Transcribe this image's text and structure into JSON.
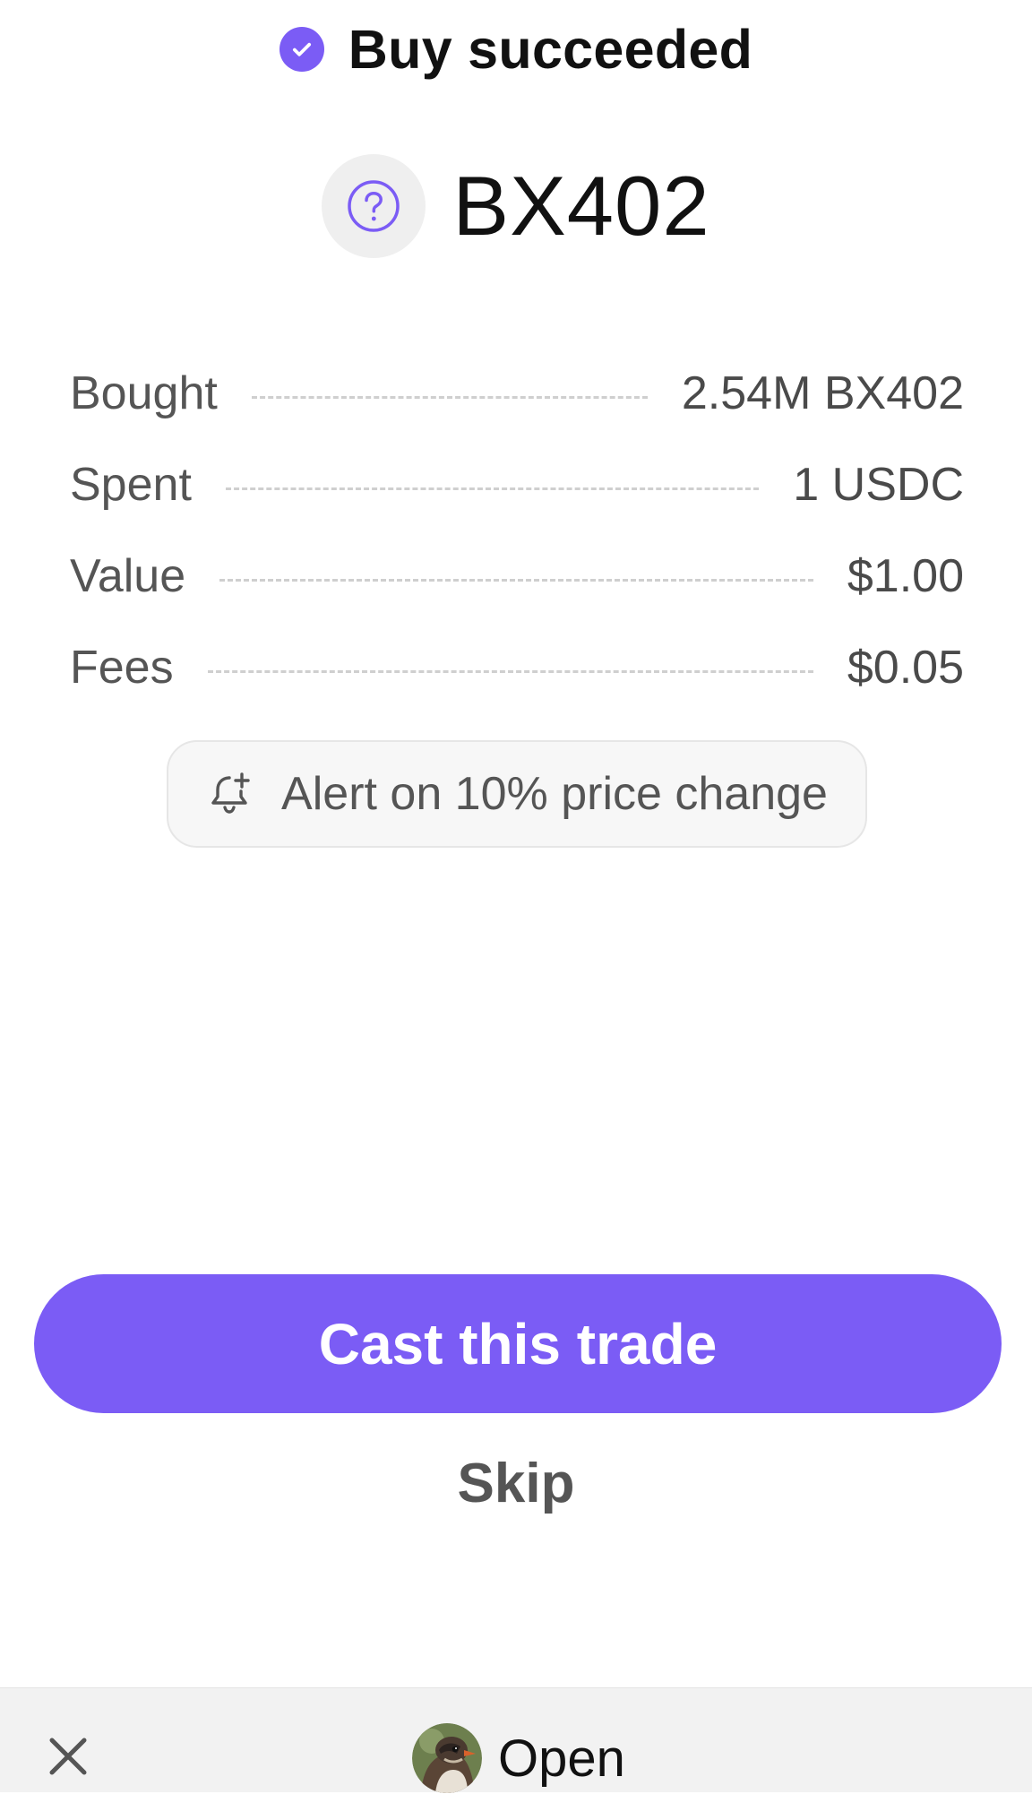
{
  "status": {
    "title": "Buy succeeded",
    "icon": "check-circle-icon",
    "accent_color": "#7B5CF5"
  },
  "token": {
    "name": "BX402",
    "icon": "question-circle-icon"
  },
  "details": [
    {
      "label": "Bought",
      "value": "2.54M BX402"
    },
    {
      "label": "Spent",
      "value": "1 USDC"
    },
    {
      "label": "Value",
      "value": "$1.00"
    },
    {
      "label": "Fees",
      "value": "$0.05"
    }
  ],
  "alert": {
    "label": "Alert on 10% price change",
    "icon": "bell-plus-icon"
  },
  "actions": {
    "cast_label": "Cast this trade",
    "skip_label": "Skip"
  },
  "bottom_bar": {
    "close_icon": "close-icon",
    "open_label": "Open",
    "avatar_icon": "bird-avatar"
  }
}
